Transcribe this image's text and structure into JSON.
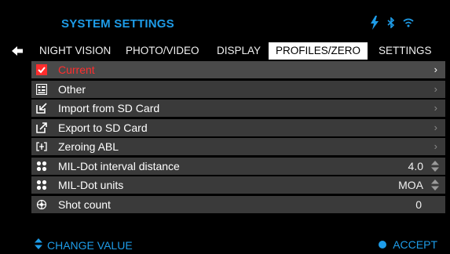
{
  "header": {
    "title": "SYSTEM SETTINGS"
  },
  "status_icons": [
    "lightning-icon",
    "bluetooth-icon",
    "wifi-icon"
  ],
  "tabs": [
    {
      "label": "NIGHT VISION"
    },
    {
      "label": "PHOTO/VIDEO"
    },
    {
      "label": "DISPLAY"
    },
    {
      "label": "PROFILES/ZERO",
      "active": true
    },
    {
      "label": "SETTINGS"
    }
  ],
  "rows": [
    {
      "label": "Current",
      "icon": "checkbox-checked-icon",
      "type": "link",
      "selected": true
    },
    {
      "label": "Other",
      "icon": "profile-list-icon",
      "type": "link"
    },
    {
      "label": "Import from SD Card",
      "icon": "import-icon",
      "type": "link"
    },
    {
      "label": "Export to SD Card",
      "icon": "export-icon",
      "type": "link"
    },
    {
      "label": "Zeroing ABL",
      "icon": "zeroing-icon",
      "type": "link"
    },
    {
      "label": "MIL-Dot interval distance",
      "icon": "mil-dot-icon",
      "type": "value",
      "value": "4.0"
    },
    {
      "label": "MIL-Dot units",
      "icon": "mil-dot-icon",
      "type": "value",
      "value": "MOA"
    },
    {
      "label": "Shot count",
      "icon": "shot-count-icon",
      "type": "readonly",
      "value": "0"
    }
  ],
  "footer": {
    "left_label": "CHANGE VALUE",
    "right_label": "ACCEPT"
  },
  "colors": {
    "accent": "#1e9ce8",
    "selected_text": "#ff2d2d",
    "row_bg": "#3a3a3a",
    "background": "#000000"
  }
}
